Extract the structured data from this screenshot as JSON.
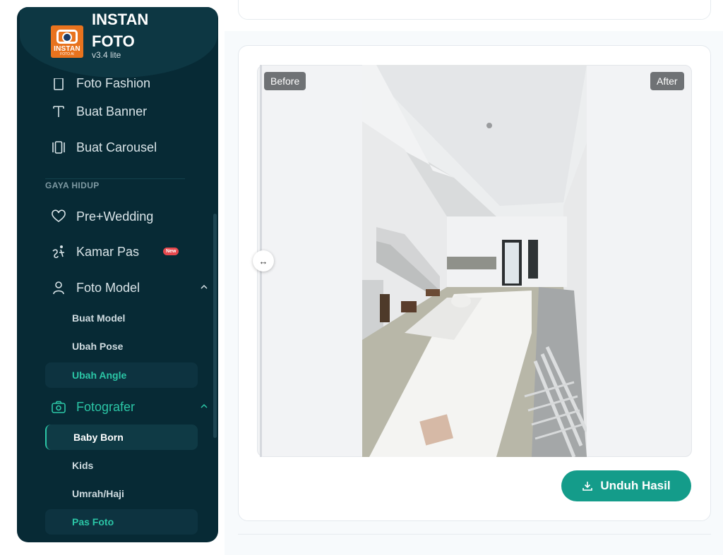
{
  "app": {
    "name_line1": "INSTAN",
    "name_line2": "FOTO",
    "version": "v3.4 lite",
    "logo_text": "INSTAN",
    "logo_sub": "FOTO AI"
  },
  "sidebar": {
    "items_top": [
      {
        "label": "Foto Fashion",
        "icon": "shirt-icon"
      },
      {
        "label": "Buat Banner",
        "icon": "text-icon"
      },
      {
        "label": "Buat Carousel",
        "icon": "carousel-icon"
      }
    ],
    "section_label": "GAYA HIDUP",
    "items_section": [
      {
        "label": "Pre+Wedding",
        "icon": "heart-icon"
      },
      {
        "label": "Kamar Pas",
        "icon": "person-hanger-icon",
        "badge": "New"
      },
      {
        "label": "Foto Model",
        "icon": "user-icon"
      }
    ],
    "foto_model_sub": [
      "Buat Model",
      "Ubah Pose",
      "Ubah Angle"
    ],
    "fotografer": {
      "label": "Fotografer",
      "icon": "camera-icon"
    },
    "fotografer_sub": [
      "Baby Born",
      "Kids",
      "Umrah/Haji",
      "Pas Foto"
    ]
  },
  "compare": {
    "before_label": "Before",
    "after_label": "After",
    "handle_glyph": "↔"
  },
  "actions": {
    "download_label": "Unduh Hasil"
  },
  "colors": {
    "sidebar_bg": "#072a35",
    "accent": "#2bc6a6",
    "button": "#149c8a",
    "badge": "#e5484d"
  }
}
